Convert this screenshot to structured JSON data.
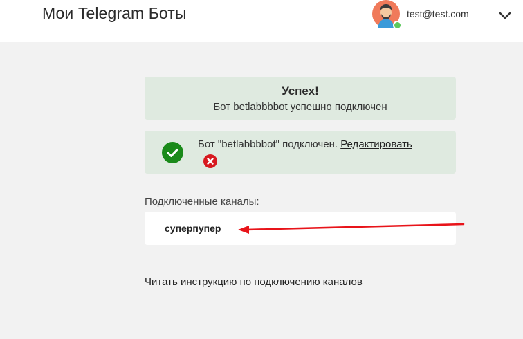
{
  "header": {
    "title": "Мои Telegram Боты",
    "user_email": "test@test.com",
    "status_color": "#5cc85c"
  },
  "success_alert": {
    "title": "Успех!",
    "message": "Бот betlabbbbot успешно подключен"
  },
  "bot_card": {
    "status_text": "Бот \"betlabbbbot\" подключен.",
    "edit_label": "Редактировать",
    "check_icon": "check-circle-icon",
    "remove_icon": "close-circle-icon"
  },
  "channels": {
    "label": "Подключенные каналы:",
    "items": [
      "суперпупер"
    ]
  },
  "instruction_link": "Читать инструкцию по подключению каналов",
  "colors": {
    "accent_green": "#1a8a1a",
    "alert_bg": "#dfeae0",
    "danger_red": "#d7191f",
    "arrow_red": "#e8141a"
  }
}
